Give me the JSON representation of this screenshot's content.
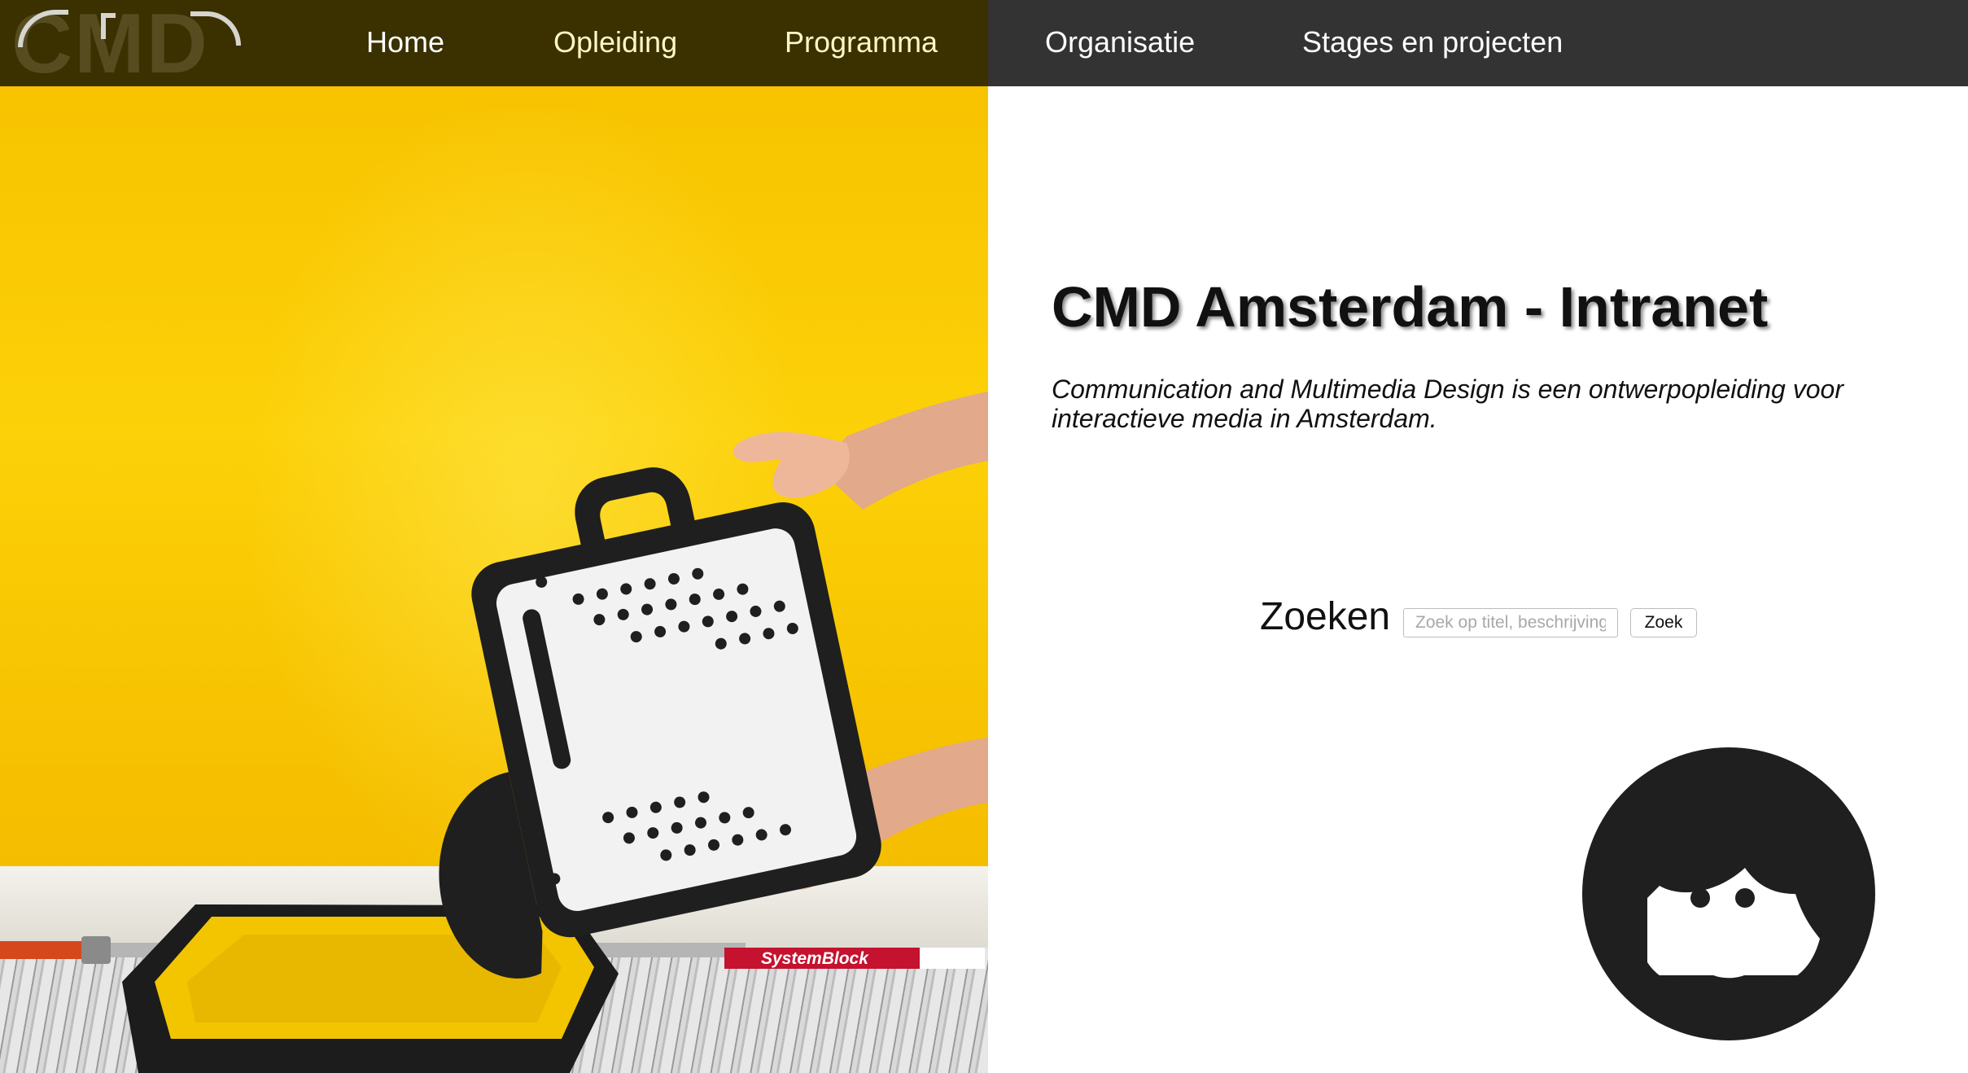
{
  "nav": {
    "logo_text": "CMD",
    "links": [
      {
        "label": "Home"
      },
      {
        "label": "Opleiding"
      },
      {
        "label": "Programma"
      },
      {
        "label": "Organisatie"
      },
      {
        "label": "Stages en projecten"
      }
    ]
  },
  "hero": {
    "brand_on_roller": "SystemBlock",
    "colors": {
      "wall": "#f8c300",
      "navbar": "#333333",
      "navbar_tint": "#3a3000"
    }
  },
  "main": {
    "title": "CMD Amsterdam - Intranet",
    "tagline": "Communication and Multimedia Design is een ontwerpopleiding voor interactieve media in Amsterdam."
  },
  "search": {
    "label": "Zoeken",
    "placeholder": "Zoek op titel, beschrijving",
    "value": "",
    "button_label": "Zoek"
  },
  "avatar": {
    "icon": "bearded-face-icon"
  }
}
